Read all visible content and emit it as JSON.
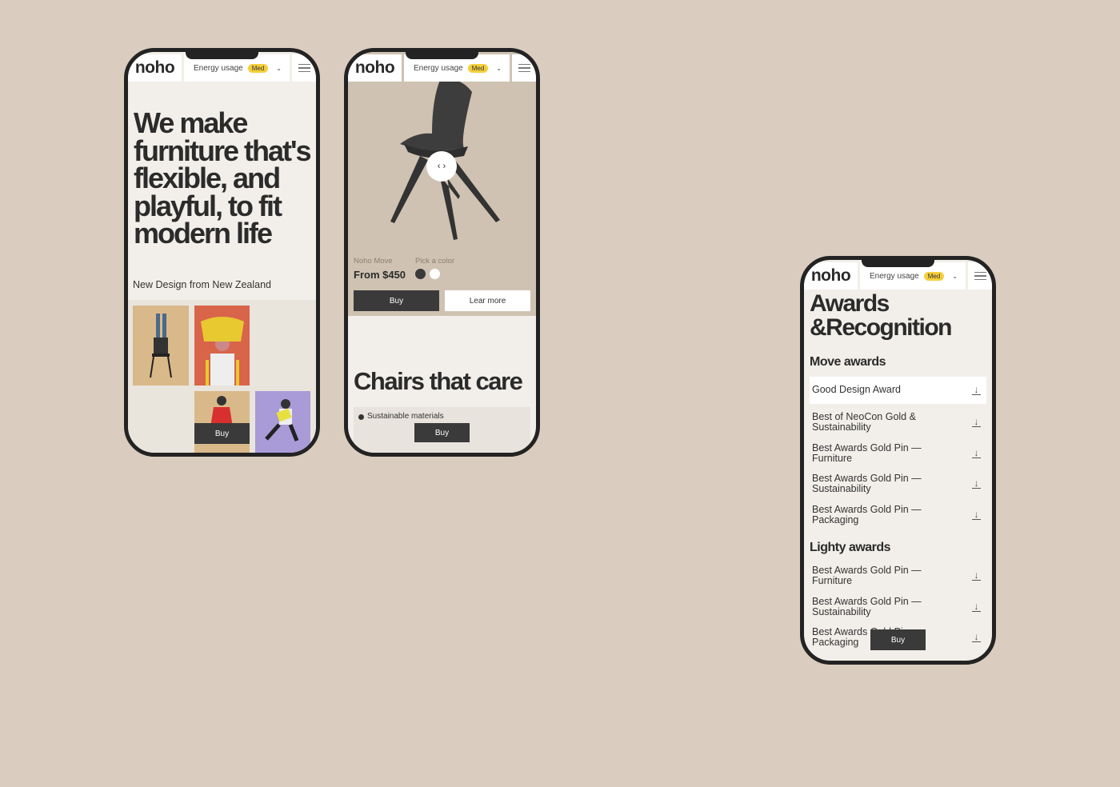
{
  "brand": {
    "logo": "noho",
    "energy_label": "Energy usage",
    "energy_badge": "Med",
    "accent": "#f5cf3c",
    "dark": "#3a3a3a"
  },
  "phone1": {
    "headline": "We make furniture that's flexible, and playful, to fit modern life",
    "tagline": "New Design from New Zealand",
    "buy_label": "Buy"
  },
  "phone2": {
    "product_name": "Noho Move",
    "price": "From $450",
    "color_label": "Pick a color",
    "colors": [
      "#3a3a3a",
      "#ffffff"
    ],
    "buy_label": "Buy",
    "learn_label": "Lear more",
    "section_title": "Chairs that care",
    "feature": "Sustainable materials",
    "buy2_label": "Buy"
  },
  "phone3": {
    "title_line1": "Awards",
    "title_line2": "&Recognition",
    "groups": [
      {
        "title": "Move awards",
        "items": [
          "Good Design Award",
          "Best of NeoCon Gold & Sustainability",
          "Best Awards Gold Pin — Furniture",
          "Best Awards Gold Pin — Sustainability",
          "Best Awards Gold Pin — Packaging"
        ]
      },
      {
        "title": "Lighty awards",
        "items": [
          "Best Awards Gold Pin — Furniture",
          "Best Awards Gold Pin — Sustainability",
          "Best Awards Gold Pin — Packaging"
        ]
      }
    ],
    "buy_label": "Buy"
  }
}
